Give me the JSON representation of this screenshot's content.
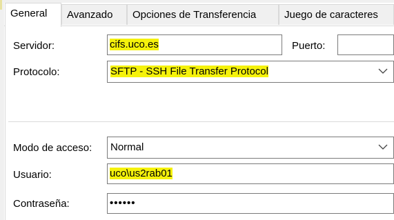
{
  "tabs": [
    {
      "label": "General",
      "active": true
    },
    {
      "label": "Avanzado",
      "active": false
    },
    {
      "label": "Opciones de Transferencia",
      "active": false
    },
    {
      "label": "Juego de caracteres",
      "active": false
    }
  ],
  "server": {
    "label": "Servidor:",
    "value": "cifs.uco.es"
  },
  "port": {
    "label": "Puerto:",
    "value": ""
  },
  "protocol": {
    "label": "Protocolo:",
    "value": "SFTP - SSH File Transfer Protocol"
  },
  "access_mode": {
    "label": "Modo de acceso:",
    "value": "Normal"
  },
  "user": {
    "label": "Usuario:",
    "value": "uco\\us2rab01"
  },
  "password": {
    "label": "Contraseña:",
    "value": "••••••"
  },
  "colors": {
    "highlight": "#f5f20b",
    "field_border": "#7a7a7a",
    "tab_border": "#d9d9d9"
  },
  "icons": {
    "dropdown": "chevron-down-icon"
  }
}
